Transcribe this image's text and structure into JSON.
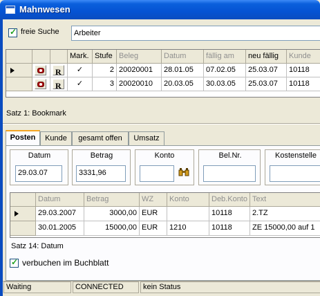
{
  "window": {
    "title": "Mahnwesen"
  },
  "search": {
    "checkbox_label": "freie Suche",
    "checked": true,
    "value": "Arbeiter"
  },
  "top_grid": {
    "columns": [
      "Mark.",
      "Stufe",
      "Beleg",
      "Datum",
      "fällig am",
      "neu fällig",
      "Kunde"
    ],
    "rows": [
      {
        "mark": "✓",
        "stufe": "2",
        "beleg": "20020001",
        "datum": "28.01.05",
        "faellig": "07.02.05",
        "neu": "25.03.07",
        "kunde": "10118"
      },
      {
        "mark": "✓",
        "stufe": "3",
        "beleg": "20020010",
        "datum": "20.03.05",
        "faellig": "30.03.05",
        "neu": "25.03.07",
        "kunde": "10118"
      }
    ],
    "status": "Satz 1: Bookmark"
  },
  "tabs": [
    "Posten",
    "Kunde",
    "gesamt offen",
    "Umsatz"
  ],
  "posten": {
    "datum_label": "Datum",
    "datum_value": "29.03.07",
    "betrag_label": "Betrag",
    "betrag_value": "3331,96",
    "konto_label": "Konto",
    "konto_value": "",
    "belnr_label": "Bel.Nr.",
    "belnr_value": "",
    "kostenstelle_label": "Kostenstelle",
    "kostenstelle_value": ""
  },
  "bottom_grid": {
    "columns": [
      "Datum",
      "Betrag",
      "WZ",
      "Konto",
      "Deb.Konto",
      "Text"
    ],
    "rows": [
      {
        "datum": "29.03.2007",
        "betrag": "3000,00",
        "wz": "EUR",
        "konto": "",
        "deb": "10118",
        "text": "2.TZ"
      },
      {
        "datum": "30.01.2005",
        "betrag": "15000,00",
        "wz": "EUR",
        "konto": "1210",
        "deb": "10118",
        "text": "ZE 15000,00 auf 1"
      }
    ],
    "status": "Satz 14: Datum"
  },
  "buchblatt": {
    "label": "verbuchen im Buchblatt",
    "checked": true
  },
  "statusbar": {
    "state": "Waiting",
    "connection": "CONNECTED",
    "status": "kein Status"
  }
}
